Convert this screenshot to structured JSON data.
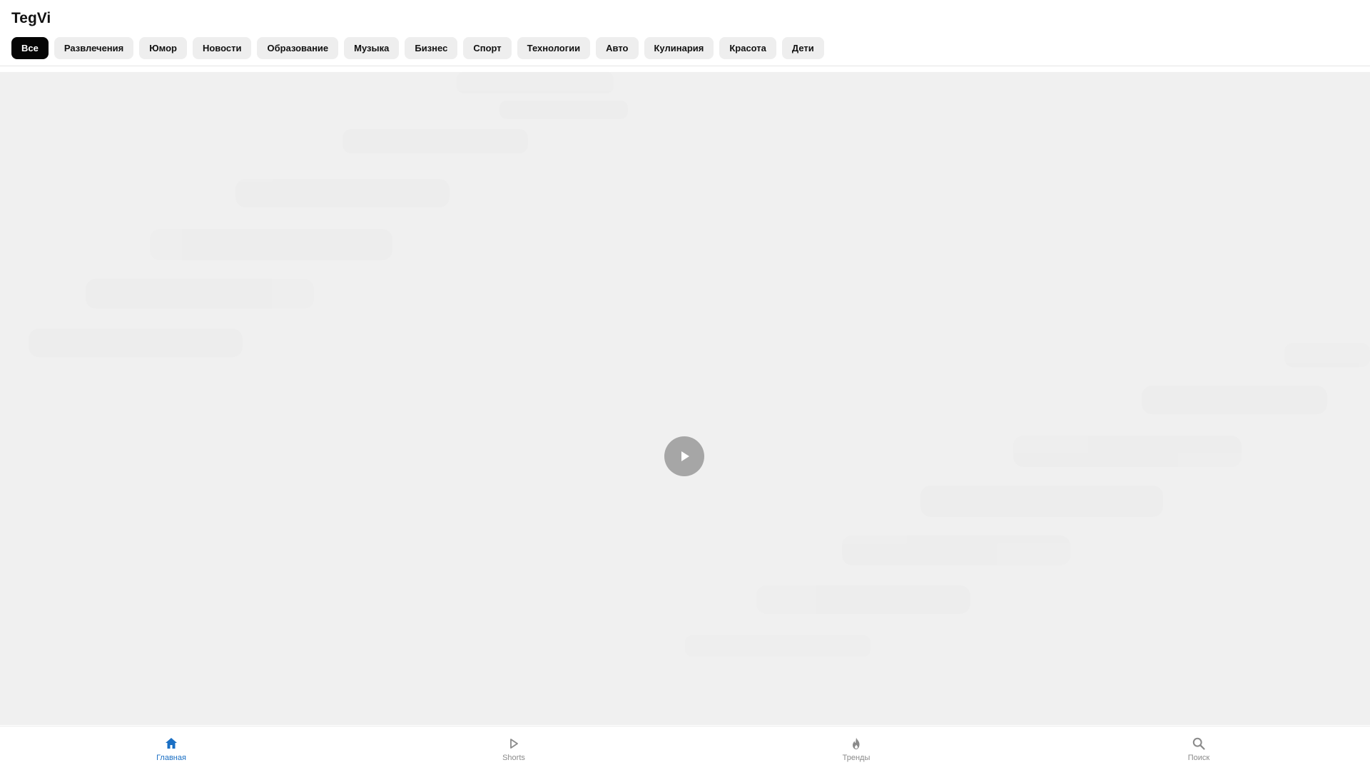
{
  "app": {
    "title": "TegVi"
  },
  "categories": [
    {
      "label": "Все",
      "active": true
    },
    {
      "label": "Развлечения",
      "active": false
    },
    {
      "label": "Юмор",
      "active": false
    },
    {
      "label": "Новости",
      "active": false
    },
    {
      "label": "Образование",
      "active": false
    },
    {
      "label": "Музыка",
      "active": false
    },
    {
      "label": "Бизнес",
      "active": false
    },
    {
      "label": "Спорт",
      "active": false
    },
    {
      "label": "Технологии",
      "active": false
    },
    {
      "label": "Авто",
      "active": false
    },
    {
      "label": "Кулинария",
      "active": false
    },
    {
      "label": "Красота",
      "active": false
    },
    {
      "label": "Дети",
      "active": false
    }
  ],
  "player": {
    "play_icon": "play-icon"
  },
  "bottom_nav": [
    {
      "label": "Главная",
      "icon": "home-icon",
      "active": true
    },
    {
      "label": "Shorts",
      "icon": "shorts-play-icon",
      "active": false
    },
    {
      "label": "Тренды",
      "icon": "flame-icon",
      "active": false
    },
    {
      "label": "Поиск",
      "icon": "search-icon",
      "active": false
    }
  ],
  "colors": {
    "accent": "#1a6fc4",
    "chip_active_bg": "#050505",
    "chip_bg": "#eeeeee",
    "video_bg": "#f0f0f0",
    "play_button_bg": "#a6a6a6"
  }
}
